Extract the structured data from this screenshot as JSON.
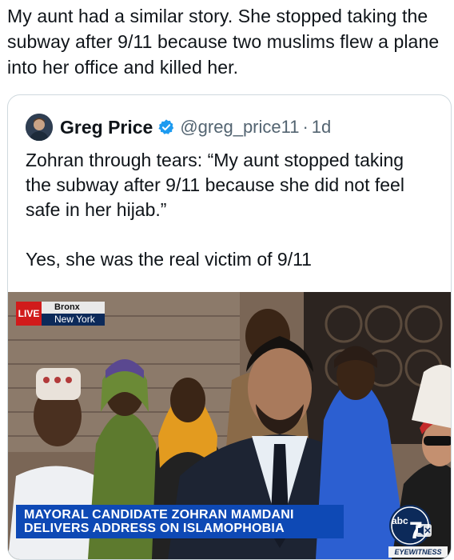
{
  "post": {
    "text": "My aunt had a similar story. She stopped taking the subway after 9/11 because two muslims flew a plane into her office and killed her."
  },
  "quoted_post": {
    "author_name": "Greg Price",
    "handle": "@greg_price11",
    "separator": "·",
    "time": "1d",
    "verified_icon": "verified-badge-icon",
    "text": "Zohran through tears: “My aunt stopped taking the subway after 9/11 because she did not feel safe in her hijab.”\n\nYes, she was the real victim of 9/11"
  },
  "video": {
    "live_label": "LIVE",
    "location_top": "Bronx",
    "location_bottom": "New York",
    "lower_third": "MAYORAL CANDIDATE ZOHRAN MAMDANI DELIVERS ADDRESS ON ISLAMOPHOBIA",
    "logo_text": "abc",
    "logo_number": "7",
    "station_tag": "EYEWITNESS NEWS"
  },
  "colors": {
    "text": "#0f1419",
    "secondary": "#536471",
    "verified": "#1d9bf0",
    "live_red": "#d11b1b",
    "banner_blue": "#0e49b5"
  }
}
